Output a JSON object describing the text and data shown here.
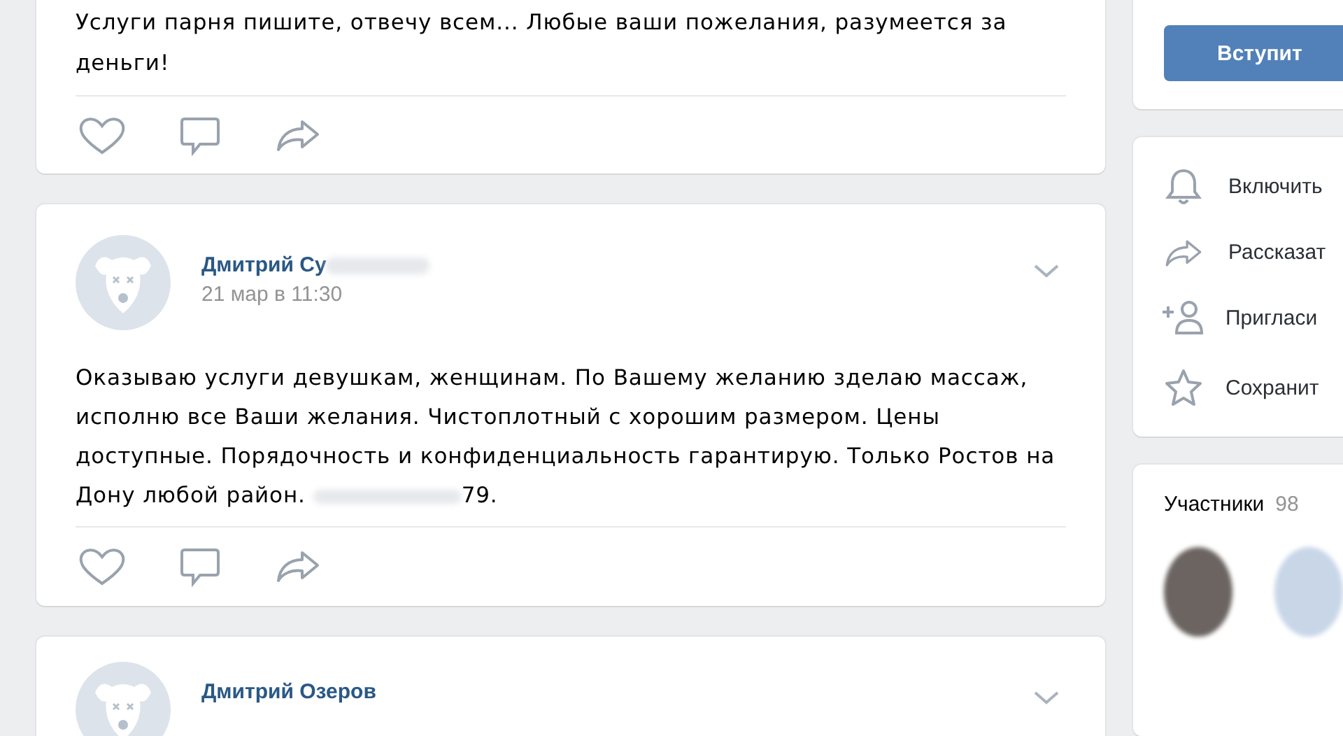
{
  "top_post": {
    "text": "Услуги парня пишите, отвечу всем... Любые ваши пожелания, разумеется за деньги!"
  },
  "posts": [
    {
      "author": "Дмитрий Су",
      "author_redacted": true,
      "date": "21 мар в 11:30",
      "text": "Оказываю услуги девушкам, женщинам. По Вашему желанию зделаю массаж, исполню все Ваши желания. Чистоплотный с хорошим размером. Цены доступные. Порядочность и конфиденциальность гарантирую. Только Ростов на Дону любой район.",
      "text_redacted": true,
      "text_end": "79."
    },
    {
      "author": "Дмитрий Озеров",
      "author_redacted": false
    }
  ],
  "sidebar": {
    "join_button": "Вступит",
    "actions": [
      {
        "kind": "bell",
        "label": "Включить"
      },
      {
        "kind": "share",
        "label": "Рассказат"
      },
      {
        "kind": "invite",
        "label": "Приглаcи"
      },
      {
        "kind": "star",
        "label": "Сохранит"
      }
    ],
    "members": {
      "title": "Участники",
      "count": "98"
    }
  }
}
